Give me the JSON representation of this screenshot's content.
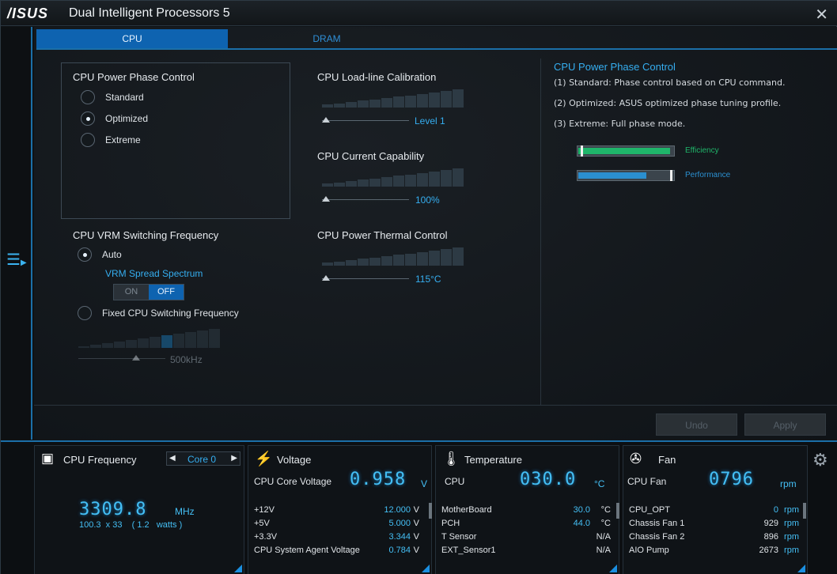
{
  "app": {
    "logo": "/ISUS",
    "title": "Dual Intelligent Processors 5",
    "close": "✕"
  },
  "tabs": [
    {
      "label": "CPU"
    },
    {
      "label": "DRAM"
    }
  ],
  "phase": {
    "title": "CPU Power Phase Control",
    "options": [
      "Standard",
      "Optimized",
      "Extreme"
    ],
    "selected": "Optimized"
  },
  "vrm": {
    "title": "CPU VRM Switching Frequency",
    "auto_label": "Auto",
    "spread_label": "VRM Spread Spectrum",
    "toggle_on": "ON",
    "toggle_off": "OFF",
    "toggle_state": "OFF",
    "fixed_label": "Fixed CPU Switching Frequency",
    "fixed_value": "500kHz",
    "selected": "Auto"
  },
  "llc": {
    "title": "CPU Load-line Calibration",
    "value": "Level 1"
  },
  "current": {
    "title": "CPU Current Capability",
    "value": "100%"
  },
  "thermal": {
    "title": "CPU Power Thermal Control",
    "value": "115°C"
  },
  "description": {
    "title": "CPU Power Phase Control",
    "lines": [
      "(1) Standard: Phase control based on CPU command.",
      "(2) Optimized: ASUS optimized phase tuning profile.",
      "(3) Extreme: Full phase mode."
    ],
    "efficiency_label": "Efficiency",
    "performance_label": "Performance",
    "efficiency_level": 0.97,
    "performance_level": 0.72,
    "colors": {
      "efficiency": "#1fb56a",
      "performance": "#2b8fd0"
    }
  },
  "buttons": {
    "undo": "Undo",
    "apply": "Apply"
  },
  "monitor": {
    "cpu_freq": {
      "title": "CPU Frequency",
      "core": "Core 0",
      "value": "3309.8",
      "unit": "MHz",
      "detail": "100.3  x 33    ( 1.2   watts )"
    },
    "voltage": {
      "title": "Voltage",
      "main_label": "CPU Core Voltage",
      "main_value": "0.958",
      "main_unit": "V",
      "rows": [
        {
          "label": "+12V",
          "value": "12.000",
          "unit": "V"
        },
        {
          "label": "+5V",
          "value": "5.000",
          "unit": "V"
        },
        {
          "label": "+3.3V",
          "value": "3.344",
          "unit": "V"
        },
        {
          "label": "CPU System Agent Voltage",
          "value": "0.784",
          "unit": "V"
        }
      ]
    },
    "temperature": {
      "title": "Temperature",
      "main_label": "CPU",
      "main_value": "030.0",
      "main_unit": "°C",
      "rows": [
        {
          "label": "MotherBoard",
          "value": "30.0",
          "unit": "°C"
        },
        {
          "label": "PCH",
          "value": "44.0",
          "unit": "°C"
        },
        {
          "label": "T Sensor",
          "value": "N/A",
          "unit": ""
        },
        {
          "label": "EXT_Sensor1",
          "value": "N/A",
          "unit": ""
        }
      ]
    },
    "fan": {
      "title": "Fan",
      "main_label": "CPU Fan",
      "main_value": "0796",
      "main_unit": "rpm",
      "rows": [
        {
          "label": "CPU_OPT",
          "value": "0",
          "unit": "rpm"
        },
        {
          "label": "Chassis Fan 1",
          "value": "929",
          "unit": "rpm"
        },
        {
          "label": "Chassis Fan 2",
          "value": "896",
          "unit": "rpm"
        },
        {
          "label": "AIO Pump",
          "value": "2673",
          "unit": "rpm"
        }
      ]
    }
  }
}
